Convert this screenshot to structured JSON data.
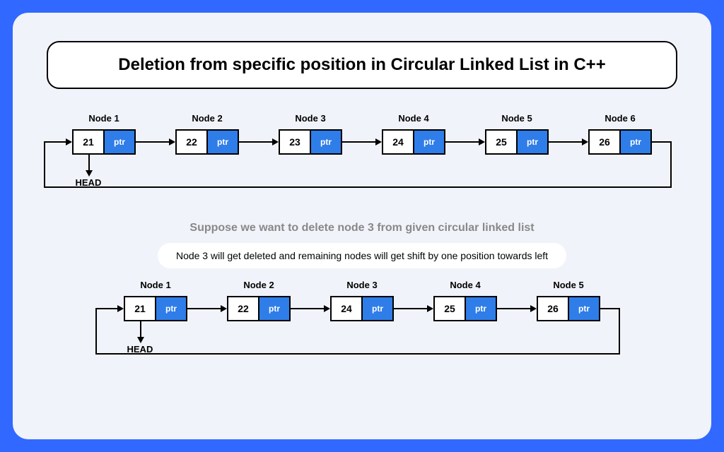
{
  "title": "Deletion from specific position in Circular Linked List in C++",
  "ptr_text": "ptr",
  "head_text": "HEAD",
  "caption_gray": "Suppose we want to delete node 3 from given circular linked list",
  "caption_pill": "Node 3 will get deleted and remaining nodes will get shift by one position towards left",
  "list_before": [
    {
      "label": "Node 1",
      "value": "21"
    },
    {
      "label": "Node 2",
      "value": "22"
    },
    {
      "label": "Node 3",
      "value": "23"
    },
    {
      "label": "Node 4",
      "value": "24"
    },
    {
      "label": "Node 5",
      "value": "25"
    },
    {
      "label": "Node 6",
      "value": "26"
    }
  ],
  "list_after": [
    {
      "label": "Node 1",
      "value": "21"
    },
    {
      "label": "Node 2",
      "value": "22"
    },
    {
      "label": "Node 3",
      "value": "24"
    },
    {
      "label": "Node 4",
      "value": "25"
    },
    {
      "label": "Node 5",
      "value": "26"
    }
  ]
}
